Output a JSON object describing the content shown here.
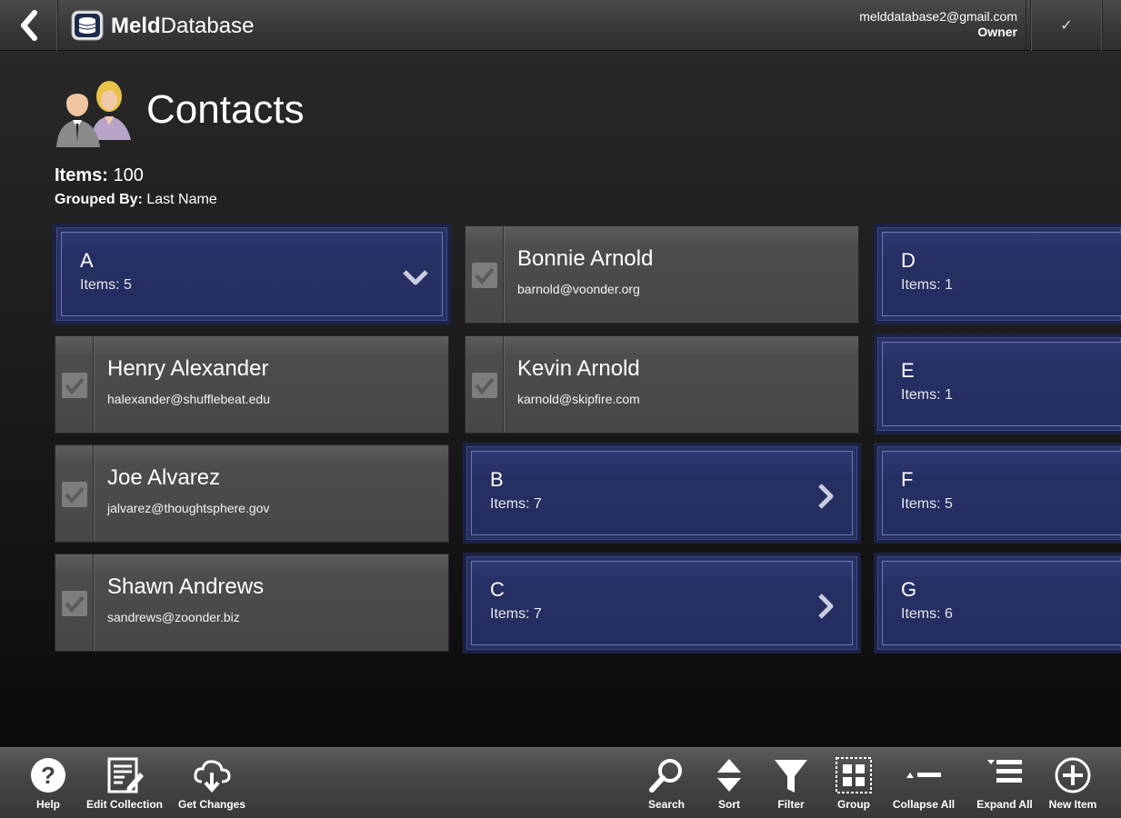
{
  "header": {
    "app_name_bold": "Meld",
    "app_name_light": "Database",
    "account_email": "melddatabase2@gmail.com",
    "account_role": "Owner",
    "confirm_glyph": "✓"
  },
  "page": {
    "title": "Contacts",
    "items_label": "Items:",
    "items_count": "100",
    "grouped_label": "Grouped By:",
    "grouped_value": "Last Name"
  },
  "groups": {
    "A": {
      "letter": "A",
      "count": "Items: 5",
      "state": "expanded"
    },
    "B": {
      "letter": "B",
      "count": "Items: 7",
      "state": "collapsed"
    },
    "C": {
      "letter": "C",
      "count": "Items: 7",
      "state": "collapsed"
    },
    "D": {
      "letter": "D",
      "count": "Items: 1"
    },
    "E": {
      "letter": "E",
      "count": "Items: 1"
    },
    "F": {
      "letter": "F",
      "count": "Items: 5"
    },
    "G": {
      "letter": "G",
      "count": "Items: 6"
    }
  },
  "contacts": [
    {
      "name": "Henry Alexander",
      "email": "halexander@shufflebeat.edu"
    },
    {
      "name": "Joe Alvarez",
      "email": "jalvarez@thoughtsphere.gov"
    },
    {
      "name": "Shawn Andrews",
      "email": "sandrews@zoonder.biz"
    },
    {
      "name": "Bonnie Arnold",
      "email": "barnold@voonder.org"
    },
    {
      "name": "Kevin Arnold",
      "email": "karnold@skipfire.com"
    }
  ],
  "toolbar": {
    "help": "Help",
    "edit_collection": "Edit Collection",
    "get_changes": "Get Changes",
    "search": "Search",
    "sort": "Sort",
    "filter": "Filter",
    "group": "Group",
    "collapse_all": "Collapse All",
    "expand_all": "Expand All",
    "new_item": "New Item"
  },
  "colors": {
    "group_card": "#273061",
    "contact_card": "#4d4d4d",
    "background": "#1d1d1d"
  }
}
